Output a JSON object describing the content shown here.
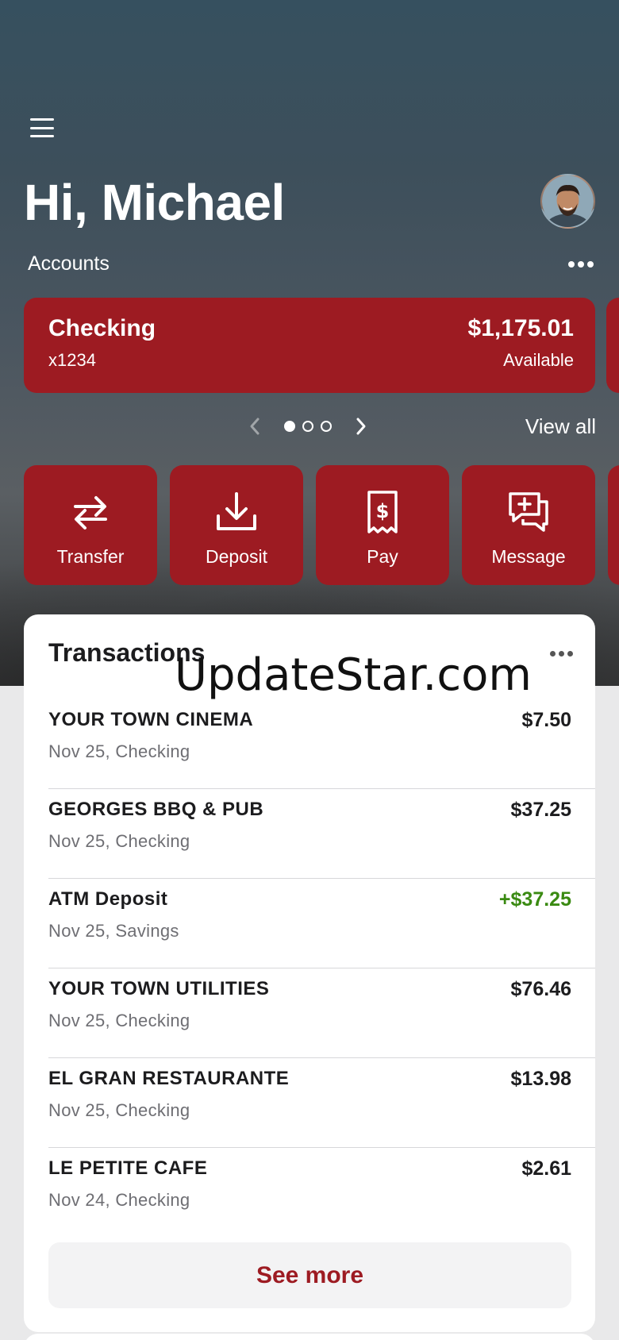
{
  "header": {
    "greeting": "Hi, Michael",
    "accounts_label": "Accounts",
    "view_all": "View all"
  },
  "account": {
    "name": "Checking",
    "number": "x1234",
    "balance": "$1,175.01",
    "balance_label": "Available",
    "pager_total": 3,
    "pager_active": 1
  },
  "actions": [
    {
      "label": "Transfer",
      "icon": "transfer-icon"
    },
    {
      "label": "Deposit",
      "icon": "deposit-icon"
    },
    {
      "label": "Pay",
      "icon": "pay-bill-icon"
    },
    {
      "label": "Message",
      "icon": "message-icon"
    }
  ],
  "transactions": {
    "title": "Transactions",
    "items": [
      {
        "merchant": "YOUR TOWN CINEMA",
        "meta": "Nov 25, Checking",
        "amount": "$7.50",
        "credit": false
      },
      {
        "merchant": "GEORGES BBQ & PUB",
        "meta": "Nov 25, Checking",
        "amount": "$37.25",
        "credit": false
      },
      {
        "merchant": "ATM Deposit",
        "meta": "Nov 25, Savings",
        "amount": "+$37.25",
        "credit": true
      },
      {
        "merchant": "YOUR TOWN UTILITIES",
        "meta": "Nov 25, Checking",
        "amount": "$76.46",
        "credit": false
      },
      {
        "merchant": "EL GRAN RESTAURANTE",
        "meta": "Nov 25, Checking",
        "amount": "$13.98",
        "credit": false
      },
      {
        "merchant": "LE PETITE CAFE",
        "meta": "Nov 24, Checking",
        "amount": "$2.61",
        "credit": false
      }
    ],
    "see_more": "See more"
  },
  "watermark": "UpdateStar.com",
  "colors": {
    "brand_red": "#9d1b22",
    "credit_green": "#3a8a12"
  }
}
